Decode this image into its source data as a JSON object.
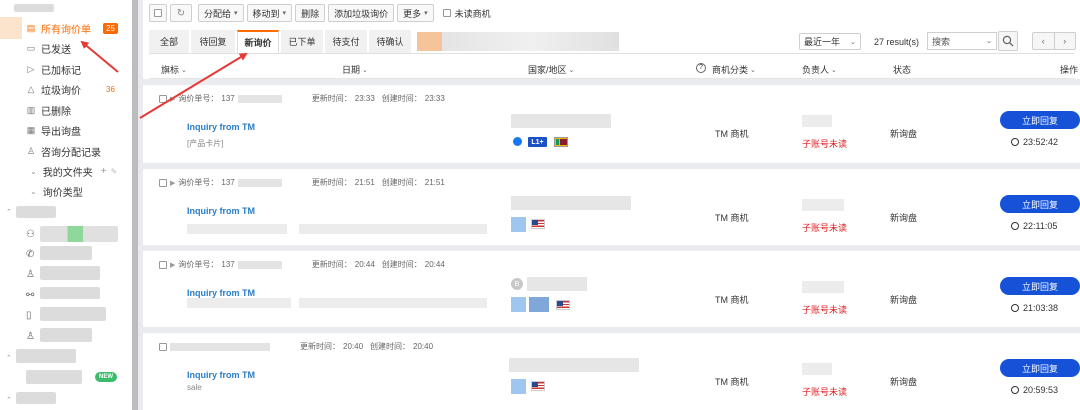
{
  "sidebar": {
    "active_item": {
      "label": "所有询价单",
      "count": "25"
    },
    "items": [
      {
        "label": "已发送",
        "icon": "send-icon"
      },
      {
        "label": "已加标记",
        "icon": "flag-icon"
      },
      {
        "label": "垃圾询价",
        "icon": "trash-icon",
        "count": "36"
      },
      {
        "label": "已删除",
        "icon": "delete-icon"
      },
      {
        "label": "导出询盘",
        "icon": "export-icon"
      },
      {
        "label": "咨询分配记录",
        "icon": "user-icon"
      }
    ],
    "folders": [
      {
        "label": "我的文件夹"
      },
      {
        "label": "询价类型"
      }
    ],
    "new_badge": "NEW"
  },
  "toolbar": {
    "assign_label": "分配给",
    "move_label": "移动到",
    "delete_label": "删除",
    "add_spam_label": "添加垃圾询价",
    "more_label": "更多",
    "unread_label": "未读商机"
  },
  "tabs": [
    {
      "label": "全部"
    },
    {
      "label": "待回复"
    },
    {
      "label": "新询价"
    },
    {
      "label": "已下单"
    },
    {
      "label": "待支付"
    },
    {
      "label": "待确认"
    }
  ],
  "filters": {
    "range": "最近一年",
    "results": "27 result(s)",
    "search_placeholder": "搜索"
  },
  "columns": {
    "flag": "旗标",
    "date": "日期",
    "country": "国家/地区",
    "category": "商机分类",
    "owner": "负责人",
    "status": "状态",
    "action": "操作"
  },
  "inquiries": [
    {
      "inquiry_no_label": "询价单号：",
      "inquiry_no": "137",
      "update_label": "更新时间：",
      "update_time": "23:33",
      "create_label": "创建时间：",
      "create_time": "23:33",
      "subject": "Inquiry from TM",
      "subtitle": "[产品卡片]",
      "category": "TM 商机",
      "owner_status": "子账号未读",
      "status": "新询盘",
      "reply_label": "立即回复",
      "timer": "23:52:42",
      "level_tag": "L1+"
    },
    {
      "inquiry_no_label": "询价单号：",
      "inquiry_no": "137",
      "update_label": "更新时间：",
      "update_time": "21:51",
      "create_label": "创建时间：",
      "create_time": "21:51",
      "subject": "Inquiry from TM",
      "category": "TM 商机",
      "owner_status": "子账号未读",
      "status": "新询盘",
      "reply_label": "立即回复",
      "timer": "22:11:05"
    },
    {
      "inquiry_no_label": "询价单号：",
      "inquiry_no": "137",
      "update_label": "更新时间：",
      "update_time": "20:44",
      "create_label": "创建时间：",
      "create_time": "20:44",
      "subject": "Inquiry from TM",
      "category": "TM 商机",
      "owner_status": "子账号未读",
      "status": "新询盘",
      "reply_label": "立即回复",
      "timer": "21:03:38",
      "avatar_letter": "B"
    },
    {
      "update_label": "更新时间：",
      "update_time": "20:40",
      "create_label": "创建时间：",
      "create_time": "20:40",
      "subject": "Inquiry from TM",
      "subtitle": "sale",
      "category": "TM 商机",
      "owner_status": "子账号未读",
      "status": "新询盘",
      "reply_label": "立即回复",
      "timer": "20:59:53"
    }
  ],
  "colors": {
    "accent": "#ff6a00",
    "link": "#2a7dc8",
    "reply_button": "#1552d8",
    "unread": "#e02020",
    "annotation": "#e53935"
  }
}
